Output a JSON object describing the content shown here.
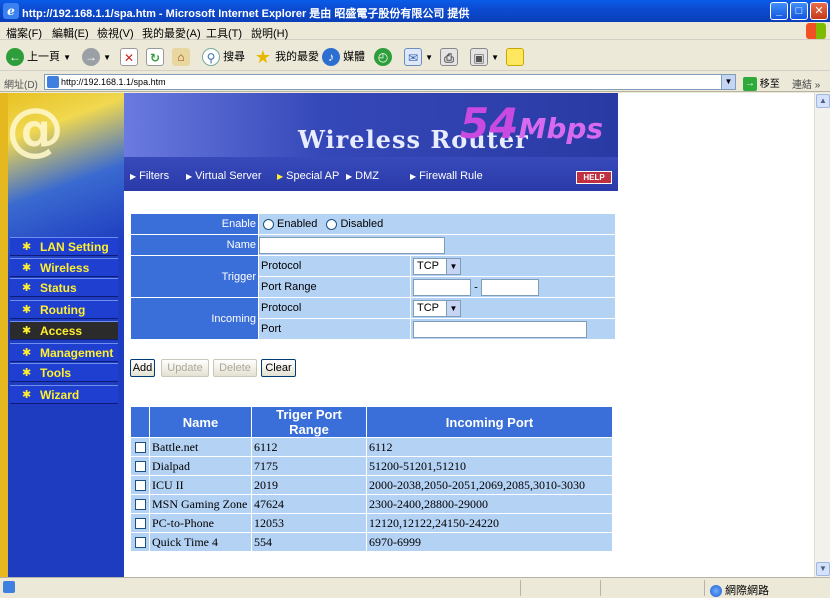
{
  "window": {
    "title": "http://192.168.1.1/spa.htm - Microsoft Internet Explorer 是由 昭盛電子股份有限公司 提供"
  },
  "menu": [
    "檔案(F)",
    "編輯(E)",
    "檢視(V)",
    "我的最愛(A)",
    "工具(T)",
    "說明(H)"
  ],
  "toolbar": {
    "back_label": "上一頁",
    "search_label": "搜尋",
    "favorites_label": "我的最愛",
    "media_label": "媒體"
  },
  "address": {
    "label": "網址(D)",
    "url": "http://192.168.1.1/spa.htm",
    "go_label": "移至",
    "links_label": "連結"
  },
  "sidebar": {
    "items": [
      {
        "label": "LAN Setting"
      },
      {
        "label": "Wireless"
      },
      {
        "label": "Status"
      },
      {
        "label": "Routing"
      },
      {
        "label": "Access"
      },
      {
        "label": "Management"
      },
      {
        "label": "Tools"
      },
      {
        "label": "Wizard"
      }
    ],
    "active": "Access"
  },
  "banner": {
    "brand": "Wireless Router",
    "speed_number": "54",
    "speed_unit": "Mbps",
    "help_label": "HELP"
  },
  "tabs": [
    {
      "label": "Filters"
    },
    {
      "label": "Virtual Server"
    },
    {
      "label": "Special AP"
    },
    {
      "label": "DMZ"
    },
    {
      "label": "Firewall Rule"
    }
  ],
  "active_tab": "Special AP",
  "form": {
    "enable_label": "Enable",
    "enabled_label": "Enabled",
    "disabled_label": "Disabled",
    "name_label": "Name",
    "name_value": "",
    "trigger_label": "Trigger",
    "trigger_protocol_label": "Protocol",
    "trigger_protocol_value": "TCP",
    "trigger_port_range_label": "Port Range",
    "trigger_port_start": "",
    "trigger_port_end": "",
    "range_sep": "-",
    "incoming_label": "Incoming",
    "incoming_protocol_label": "Protocol",
    "incoming_protocol_value": "TCP",
    "incoming_port_label": "Port",
    "incoming_port_value": ""
  },
  "buttons": {
    "add": "Add",
    "update": "Update",
    "delete": "Delete",
    "clear": "Clear"
  },
  "table": {
    "headers": [
      "Name",
      "Triger Port Range",
      "Incoming Port"
    ],
    "rows": [
      {
        "name": "Battle.net",
        "trigger": "6112",
        "incoming": "6112"
      },
      {
        "name": "Dialpad",
        "trigger": "7175",
        "incoming": "51200-51201,51210"
      },
      {
        "name": "ICU II",
        "trigger": "2019",
        "incoming": "2000-2038,2050-2051,2069,2085,3010-3030"
      },
      {
        "name": "MSN Gaming Zone",
        "trigger": "47624",
        "incoming": "2300-2400,28800-29000"
      },
      {
        "name": "PC-to-Phone",
        "trigger": "12053",
        "incoming": "12120,12122,24150-24220"
      },
      {
        "name": "Quick Time 4",
        "trigger": "554",
        "incoming": "6970-6999"
      }
    ]
  },
  "status": {
    "zone_label": "網際網路"
  },
  "colors": {
    "header_blue": "#3a6ed8",
    "cell_blue": "#b4d2f4",
    "nav_yellow": "#ffef30"
  }
}
